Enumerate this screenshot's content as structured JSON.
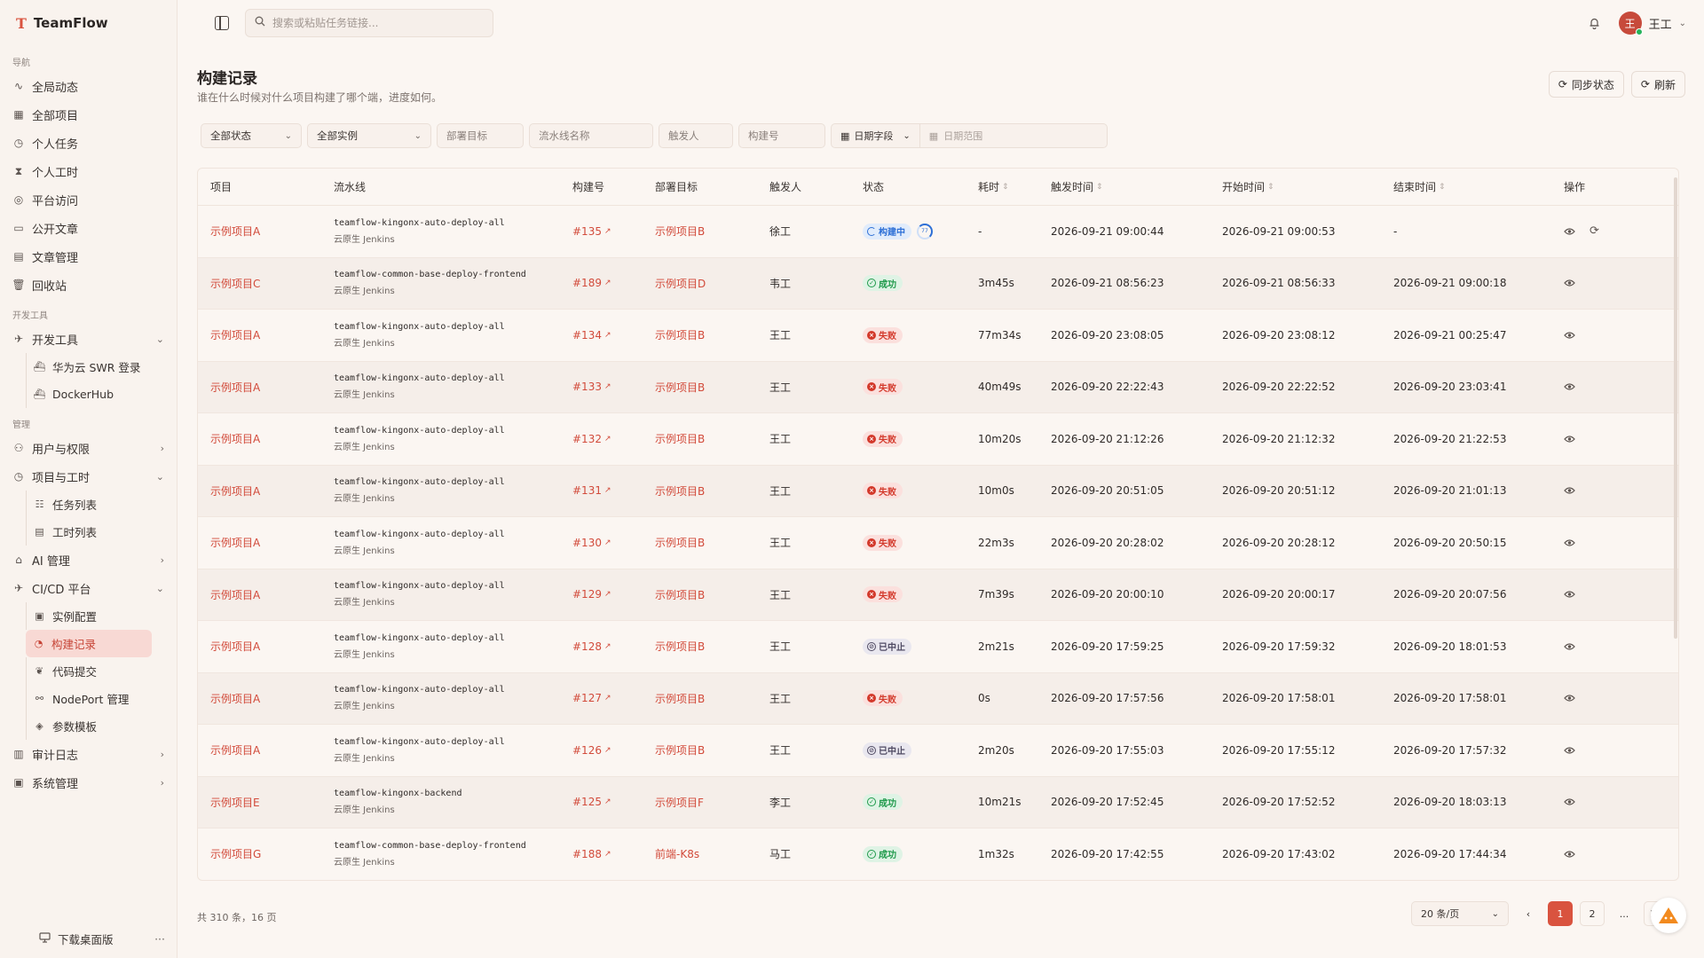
{
  "brand": {
    "logo": "T",
    "name": "TeamFlow"
  },
  "sidebar": {
    "sections": [
      {
        "title": "导航",
        "items": [
          {
            "label": "全局动态",
            "icon": "activity-icon",
            "glyph": "∿"
          },
          {
            "label": "全部项目",
            "icon": "grid-icon",
            "glyph": "▦"
          },
          {
            "label": "个人任务",
            "icon": "clock-icon",
            "glyph": "◷"
          },
          {
            "label": "个人工时",
            "icon": "hourglass-icon",
            "glyph": "⧗"
          },
          {
            "label": "平台访问",
            "icon": "globe-icon",
            "glyph": "◎"
          },
          {
            "label": "公开文章",
            "icon": "book-icon",
            "glyph": "▭"
          },
          {
            "label": "文章管理",
            "icon": "document-icon",
            "glyph": "▤"
          },
          {
            "label": "回收站",
            "icon": "trash-icon",
            "glyph": "🗑"
          }
        ]
      },
      {
        "title": "开发工具",
        "items": [
          {
            "label": "开发工具",
            "icon": "rocket-icon",
            "glyph": "✈",
            "chevron": "⌄",
            "children": [
              {
                "label": "华为云 SWR 登录",
                "icon": "docker-icon",
                "glyph": "⛴"
              },
              {
                "label": "DockerHub",
                "icon": "docker-icon",
                "glyph": "⛴"
              }
            ]
          }
        ]
      },
      {
        "title": "管理",
        "items": [
          {
            "label": "用户与权限",
            "icon": "users-icon",
            "glyph": "⚇",
            "chevron": "›"
          },
          {
            "label": "项目与工时",
            "icon": "clock-icon",
            "glyph": "◷",
            "chevron": "⌄",
            "children": [
              {
                "label": "任务列表",
                "icon": "list-icon",
                "glyph": "☷"
              },
              {
                "label": "工时列表",
                "icon": "document-icon",
                "glyph": "▤"
              }
            ]
          },
          {
            "label": "AI 管理",
            "icon": "briefcase-icon",
            "glyph": "⌂",
            "chevron": "›"
          },
          {
            "label": "CI/CD 平台",
            "icon": "rocket-icon",
            "glyph": "✈",
            "chevron": "⌄",
            "children": [
              {
                "label": "实例配置",
                "icon": "server-icon",
                "glyph": "▣"
              },
              {
                "label": "构建记录",
                "icon": "build-icon",
                "glyph": "◔",
                "active": true
              },
              {
                "label": "代码提交",
                "icon": "git-icon",
                "glyph": "❦"
              },
              {
                "label": "NodePort 管理",
                "icon": "network-icon",
                "glyph": "⚯"
              },
              {
                "label": "参数模板",
                "icon": "layers-icon",
                "glyph": "◈"
              }
            ]
          },
          {
            "label": "审计日志",
            "icon": "audit-icon",
            "glyph": "▥",
            "chevron": "›"
          },
          {
            "label": "系统管理",
            "icon": "settings-icon",
            "glyph": "▣",
            "chevron": "›"
          }
        ]
      }
    ],
    "footer": {
      "label": "下载桌面版",
      "more": "···"
    }
  },
  "topbar": {
    "search_placeholder": "搜索或粘贴任务链接...",
    "user": {
      "avatar": "王",
      "name": "王工"
    }
  },
  "page": {
    "title": "构建记录",
    "subtitle": "谁在什么时候对什么项目构建了哪个端，进度如何。",
    "sync_label": "同步状态",
    "refresh_label": "刷新"
  },
  "filters": {
    "status": "全部状态",
    "instance": "全部实例",
    "deploy_target": "部署目标",
    "pipeline_name": "流水线名称",
    "trigger": "触发人",
    "build_no": "构建号",
    "date_field": "日期字段",
    "date_range": "日期范围"
  },
  "table": {
    "columns": [
      "项目",
      "流水线",
      "构建号",
      "部署目标",
      "触发人",
      "状态",
      "耗时",
      "触发时间",
      "开始时间",
      "结束时间",
      "操作"
    ],
    "rows": [
      {
        "project": "示例项目A",
        "pipeline": "teamflow-kingonx-auto-deploy-all",
        "source": "云原生 Jenkins",
        "build": "#135",
        "target": "示例项目B",
        "trigger": "徐工",
        "status": "running",
        "status_label": "构建中",
        "progress": "77",
        "duration": "-",
        "triggered": "2026-09-21 09:00:44",
        "started": "2026-09-21 09:00:53",
        "ended": "-",
        "retry": true
      },
      {
        "project": "示例项目C",
        "pipeline": "teamflow-common-base-deploy-frontend",
        "source": "云原生 Jenkins",
        "build": "#189",
        "target": "示例项目D",
        "trigger": "韦工",
        "status": "success",
        "status_label": "成功",
        "duration": "3m45s",
        "triggered": "2026-09-21 08:56:23",
        "started": "2026-09-21 08:56:33",
        "ended": "2026-09-21 09:00:18"
      },
      {
        "project": "示例项目A",
        "pipeline": "teamflow-kingonx-auto-deploy-all",
        "source": "云原生 Jenkins",
        "build": "#134",
        "target": "示例项目B",
        "trigger": "王工",
        "status": "failed",
        "status_label": "失败",
        "duration": "77m34s",
        "triggered": "2026-09-20 23:08:05",
        "started": "2026-09-20 23:08:12",
        "ended": "2026-09-21 00:25:47"
      },
      {
        "project": "示例项目A",
        "pipeline": "teamflow-kingonx-auto-deploy-all",
        "source": "云原生 Jenkins",
        "build": "#133",
        "target": "示例项目B",
        "trigger": "王工",
        "status": "failed",
        "status_label": "失败",
        "duration": "40m49s",
        "triggered": "2026-09-20 22:22:43",
        "started": "2026-09-20 22:22:52",
        "ended": "2026-09-20 23:03:41"
      },
      {
        "project": "示例项目A",
        "pipeline": "teamflow-kingonx-auto-deploy-all",
        "source": "云原生 Jenkins",
        "build": "#132",
        "target": "示例项目B",
        "trigger": "王工",
        "status": "failed",
        "status_label": "失败",
        "duration": "10m20s",
        "triggered": "2026-09-20 21:12:26",
        "started": "2026-09-20 21:12:32",
        "ended": "2026-09-20 21:22:53"
      },
      {
        "project": "示例项目A",
        "pipeline": "teamflow-kingonx-auto-deploy-all",
        "source": "云原生 Jenkins",
        "build": "#131",
        "target": "示例项目B",
        "trigger": "王工",
        "status": "failed",
        "status_label": "失败",
        "duration": "10m0s",
        "triggered": "2026-09-20 20:51:05",
        "started": "2026-09-20 20:51:12",
        "ended": "2026-09-20 21:01:13"
      },
      {
        "project": "示例项目A",
        "pipeline": "teamflow-kingonx-auto-deploy-all",
        "source": "云原生 Jenkins",
        "build": "#130",
        "target": "示例项目B",
        "trigger": "王工",
        "status": "failed",
        "status_label": "失败",
        "duration": "22m3s",
        "triggered": "2026-09-20 20:28:02",
        "started": "2026-09-20 20:28:12",
        "ended": "2026-09-20 20:50:15"
      },
      {
        "project": "示例项目A",
        "pipeline": "teamflow-kingonx-auto-deploy-all",
        "source": "云原生 Jenkins",
        "build": "#129",
        "target": "示例项目B",
        "trigger": "王工",
        "status": "failed",
        "status_label": "失败",
        "duration": "7m39s",
        "triggered": "2026-09-20 20:00:10",
        "started": "2026-09-20 20:00:17",
        "ended": "2026-09-20 20:07:56"
      },
      {
        "project": "示例项目A",
        "pipeline": "teamflow-kingonx-auto-deploy-all",
        "source": "云原生 Jenkins",
        "build": "#128",
        "target": "示例项目B",
        "trigger": "王工",
        "status": "aborted",
        "status_label": "已中止",
        "duration": "2m21s",
        "triggered": "2026-09-20 17:59:25",
        "started": "2026-09-20 17:59:32",
        "ended": "2026-09-20 18:01:53"
      },
      {
        "project": "示例项目A",
        "pipeline": "teamflow-kingonx-auto-deploy-all",
        "source": "云原生 Jenkins",
        "build": "#127",
        "target": "示例项目B",
        "trigger": "王工",
        "status": "failed",
        "status_label": "失败",
        "duration": "0s",
        "triggered": "2026-09-20 17:57:56",
        "started": "2026-09-20 17:58:01",
        "ended": "2026-09-20 17:58:01"
      },
      {
        "project": "示例项目A",
        "pipeline": "teamflow-kingonx-auto-deploy-all",
        "source": "云原生 Jenkins",
        "build": "#126",
        "target": "示例项目B",
        "trigger": "王工",
        "status": "aborted",
        "status_label": "已中止",
        "duration": "2m20s",
        "triggered": "2026-09-20 17:55:03",
        "started": "2026-09-20 17:55:12",
        "ended": "2026-09-20 17:57:32"
      },
      {
        "project": "示例项目E",
        "pipeline": "teamflow-kingonx-backend",
        "source": "云原生 Jenkins",
        "build": "#125",
        "target": "示例项目F",
        "trigger": "李工",
        "status": "success",
        "status_label": "成功",
        "duration": "10m21s",
        "triggered": "2026-09-20 17:52:45",
        "started": "2026-09-20 17:52:52",
        "ended": "2026-09-20 18:03:13"
      },
      {
        "project": "示例项目G",
        "pipeline": "teamflow-common-base-deploy-frontend",
        "source": "云原生 Jenkins",
        "build": "#188",
        "target": "前端-K8s",
        "trigger": "马工",
        "status": "success",
        "status_label": "成功",
        "duration": "1m32s",
        "triggered": "2026-09-20 17:42:55",
        "started": "2026-09-20 17:43:02",
        "ended": "2026-09-20 17:44:34"
      }
    ]
  },
  "footer": {
    "total": "共 310 条，16 页",
    "per_page": "20 条/页",
    "prev": "‹",
    "pages": [
      "1",
      "2"
    ],
    "ellipsis": "...",
    "last_page": "16",
    "current_page": "1"
  },
  "colors": {
    "accent": "#d9533f",
    "link": "#d24b3b",
    "running": "#2d6fd6",
    "success": "#1f9a4b",
    "failed": "#d3392b",
    "aborted": "#4f4a63"
  }
}
